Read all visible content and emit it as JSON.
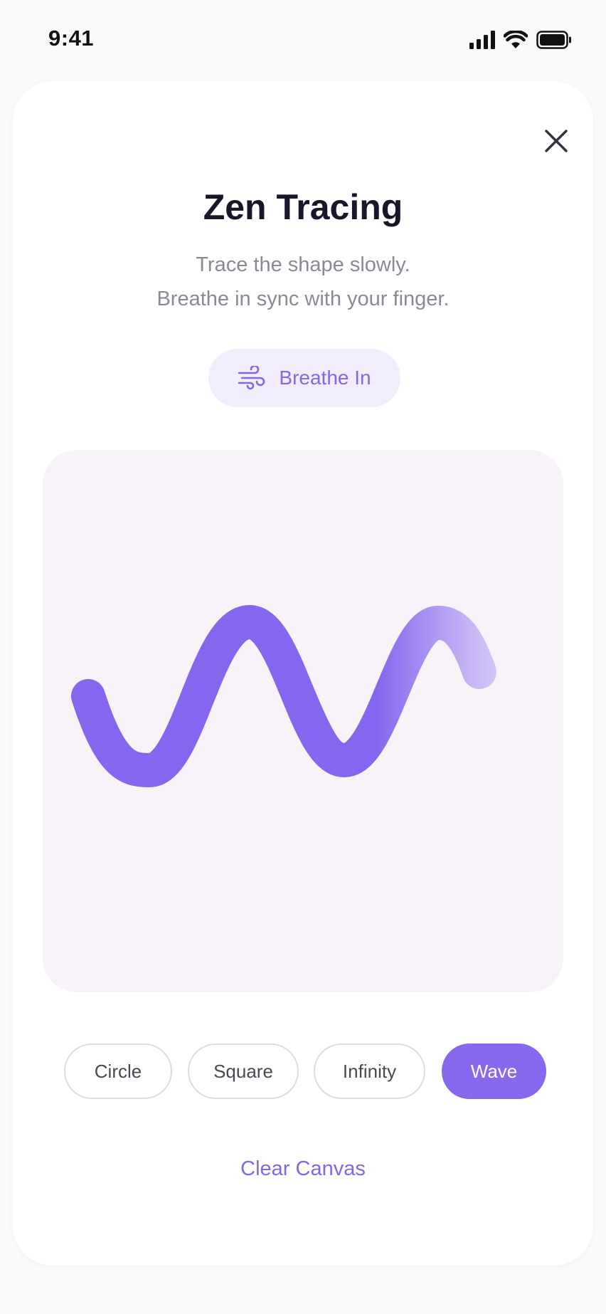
{
  "status_bar": {
    "time": "9:41",
    "icons": [
      "cellular-signal-icon",
      "wifi-icon",
      "battery-icon"
    ]
  },
  "header": {
    "close_icon": "close-icon",
    "title": "Zen Tracing",
    "subtitle_line1": "Trace the shape slowly.",
    "subtitle_line2": "Breathe in sync with your finger."
  },
  "breathe": {
    "icon": "wind-icon",
    "label": "Breathe In"
  },
  "canvas": {
    "traced_shape": "wave",
    "stroke_color": "#8666ee",
    "fade_color": "#d8c9f4",
    "background": "#f8f2f9"
  },
  "shapes": [
    {
      "label": "Circle",
      "selected": false
    },
    {
      "label": "Square",
      "selected": false
    },
    {
      "label": "Infinity",
      "selected": false
    },
    {
      "label": "Wave",
      "selected": true
    }
  ],
  "actions": {
    "clear_label": "Clear Canvas"
  },
  "colors": {
    "accent": "#8869ee",
    "accent_text": "#8565ea",
    "pill_bg": "#f1edfc",
    "title": "#17162a",
    "muted": "#8b8a94"
  }
}
